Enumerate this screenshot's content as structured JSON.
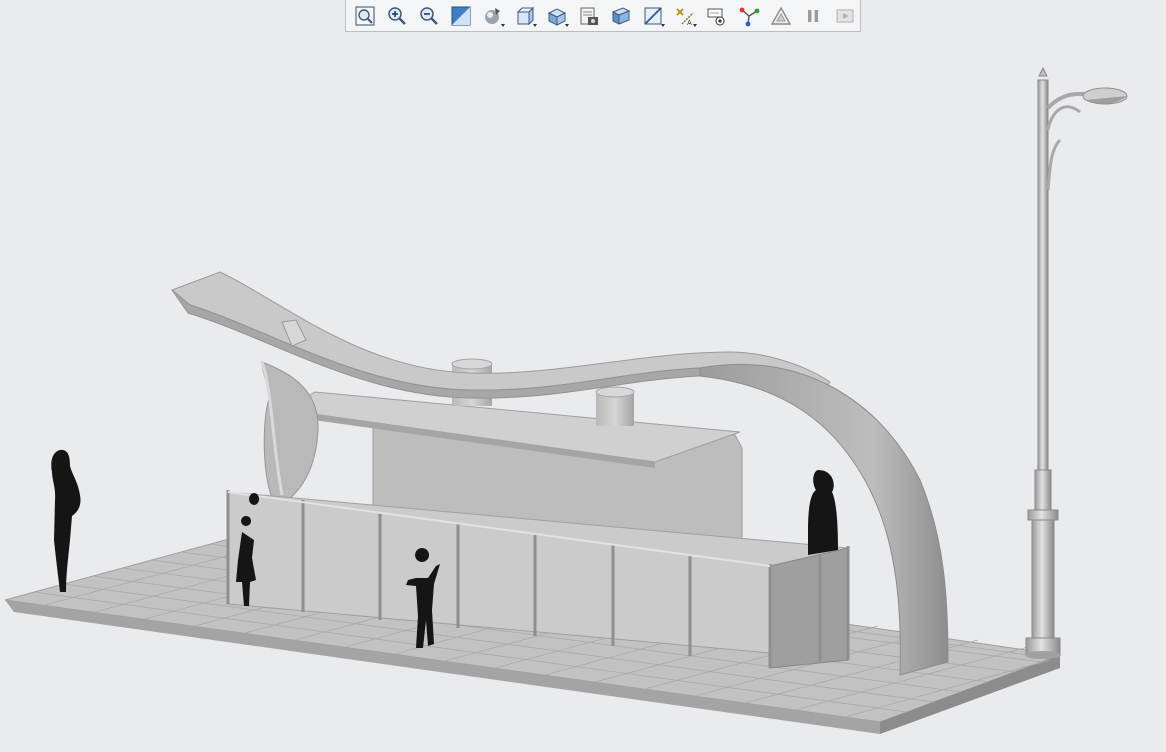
{
  "toolbar": {
    "buttons": [
      {
        "name": "refit-icon"
      },
      {
        "name": "zoom-in-icon"
      },
      {
        "name": "zoom-out-icon"
      },
      {
        "name": "repaint-icon"
      },
      {
        "name": "display-style-icon"
      },
      {
        "name": "saved-orientations-icon"
      },
      {
        "name": "view-manager-icon"
      },
      {
        "name": "appearance-icon"
      },
      {
        "name": "perspective-view-icon"
      },
      {
        "name": "section-icon"
      },
      {
        "name": "datum-display-icon"
      },
      {
        "name": "annotation-display-icon"
      },
      {
        "name": "spin-center-icon"
      },
      {
        "name": "simplify-icon"
      },
      {
        "name": "pause-icon"
      },
      {
        "name": "next-icon"
      }
    ]
  },
  "colors": {
    "background": "#eaebee",
    "model_light": "#c8c8c8",
    "model_mid": "#a9a9a9",
    "model_dark": "#8c8c8c",
    "silhouette": "#151515"
  }
}
